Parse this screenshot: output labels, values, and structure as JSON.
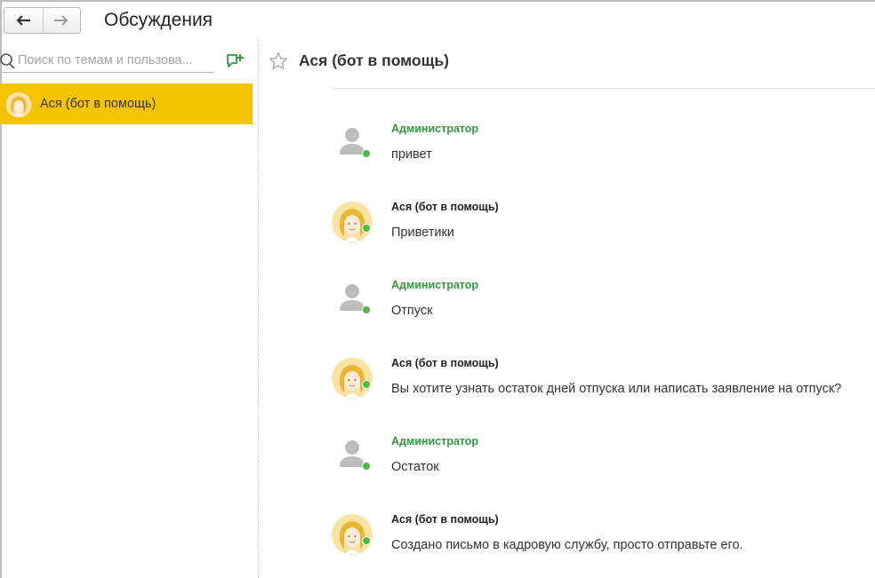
{
  "header": {
    "title": "Обсуждения",
    "back_icon": "arrow-left-icon",
    "forward_icon": "arrow-right-icon"
  },
  "sidebar": {
    "search_placeholder": "Поиск по темам и пользова...",
    "topics": [
      {
        "label": "Ася (бот в помощь)",
        "selected": true
      }
    ]
  },
  "thread": {
    "title": "Ася (бот в помощь)",
    "messages": [
      {
        "author": "Администратор",
        "role": "admin",
        "text": "привет"
      },
      {
        "author": "Ася (бот в помощь)",
        "role": "bot",
        "text": "Приветики"
      },
      {
        "author": "Администратор",
        "role": "admin",
        "text": "Отпуск"
      },
      {
        "author": "Ася (бот в помощь)",
        "role": "bot",
        "text": "Вы хотите узнать остаток дней отпуска или написать заявление на отпуск?"
      },
      {
        "author": "Администратор",
        "role": "admin",
        "text": "Остаток"
      },
      {
        "author": "Ася (бот в помощь)",
        "role": "bot",
        "text": "Создано письмо в кадровую службу, просто отправьте его."
      }
    ]
  },
  "colors": {
    "selected_topic": "#f6c301",
    "admin_name": "#2e9a3e",
    "online": "#4cb944"
  }
}
